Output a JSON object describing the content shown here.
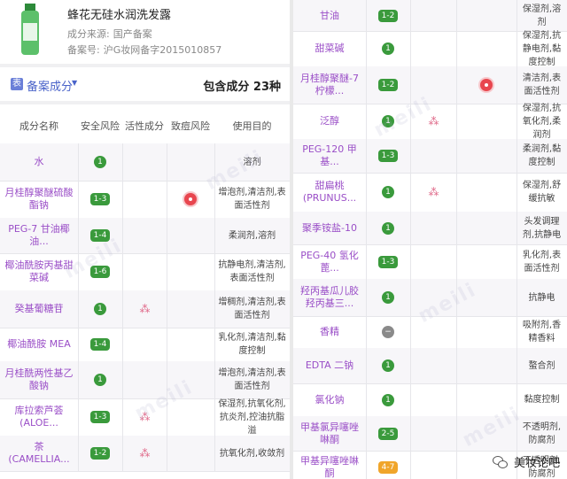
{
  "product": {
    "title": "蜂花无硅水润洗发露",
    "source_label": "成分来源:",
    "source_value": "国产备案",
    "record_label": "备案号:",
    "record_value": "沪G妆网备字2015010857"
  },
  "section": {
    "icon_text": "表",
    "label": "备案成分",
    "count_text": "包含成分 23种"
  },
  "table_headers": [
    "成分名称",
    "安全风险",
    "活性成分",
    "致痘风险",
    "使用目的"
  ],
  "left_rows": [
    {
      "name": "水",
      "safety": "1",
      "active": false,
      "acne": false,
      "purpose": "溶剂"
    },
    {
      "name": "月桂醇聚醚硫酸酯钠",
      "safety": "1-3",
      "active": false,
      "acne": true,
      "purpose": "增泡剂,清洁剂,表面活性剂"
    },
    {
      "name": "PEG-7 甘油椰油...",
      "safety": "1-4",
      "active": false,
      "acne": false,
      "purpose": "柔润剂,溶剂"
    },
    {
      "name": "椰油酰胺丙基甜菜碱",
      "safety": "1-6",
      "active": false,
      "acne": false,
      "purpose": "抗静电剂,清洁剂,表面活性剂"
    },
    {
      "name": "癸基葡糖苷",
      "safety": "1",
      "active": true,
      "acne": false,
      "purpose": "增稠剂,清洁剂,表面活性剂"
    },
    {
      "name": "椰油酰胺 MEA",
      "safety": "1-4",
      "active": false,
      "acne": false,
      "purpose": "乳化剂,清洁剂,黏度控制"
    },
    {
      "name": "月桂酰两性基乙酸钠",
      "safety": "1",
      "active": false,
      "acne": false,
      "purpose": "增泡剂,清洁剂,表面活性剂"
    },
    {
      "name": "库拉索芦荟(ALOE...",
      "safety": "1-3",
      "active": true,
      "acne": false,
      "purpose": "保湿剂,抗氧化剂,抗炎剂,控油抗脂溢"
    },
    {
      "name": "茶(CAMELLIA...",
      "safety": "1-2",
      "active": true,
      "acne": false,
      "purpose": "抗氧化剂,收敛剂"
    }
  ],
  "right_rows": [
    {
      "name": "甘油",
      "safety": "1-2",
      "active": false,
      "acne": false,
      "purpose": "保湿剂,溶剂"
    },
    {
      "name": "甜菜碱",
      "safety": "1",
      "active": false,
      "acne": false,
      "purpose": "保湿剂,抗静电剂,黏度控制"
    },
    {
      "name": "月桂醇聚醚-7 柠檬...",
      "safety": "1-2",
      "active": false,
      "acne": true,
      "purpose": "清洁剂,表面活性剂"
    },
    {
      "name": "泛醇",
      "safety": "1",
      "active": true,
      "acne": false,
      "purpose": "保湿剂,抗氧化剂,柔润剂"
    },
    {
      "name": "PEG-120 甲基...",
      "safety": "1-3",
      "active": false,
      "acne": false,
      "purpose": "柔润剂,黏度控制"
    },
    {
      "name": "甜扁桃(PRUNUS...",
      "safety": "1",
      "active": true,
      "acne": false,
      "purpose": "保湿剂,舒缓抗敏"
    },
    {
      "name": "聚季铵盐-10",
      "safety": "1",
      "active": false,
      "acne": false,
      "purpose": "头发调理剂,抗静电"
    },
    {
      "name": "PEG-40 氢化蓖...",
      "safety": "1-3",
      "active": false,
      "acne": false,
      "purpose": "乳化剂,表面活性剂"
    },
    {
      "name": "羟丙基瓜儿胶羟丙基三...",
      "safety": "1",
      "active": false,
      "acne": false,
      "purpose": "抗静电"
    },
    {
      "name": "香精",
      "safety": "-",
      "active": false,
      "acne": false,
      "purpose": "吸附剂,香精香料"
    },
    {
      "name": "EDTA 二钠",
      "safety": "1",
      "active": false,
      "acne": false,
      "purpose": "螯合剂"
    },
    {
      "name": "氯化钠",
      "safety": "1",
      "active": false,
      "acne": false,
      "purpose": "黏度控制"
    },
    {
      "name": "甲基氯异噻唑啉酮",
      "safety": "2-5",
      "active": false,
      "acne": false,
      "purpose": "不透明剂,防腐剂"
    },
    {
      "name": "甲基异噻唑啉酮",
      "safety": "4-7",
      "active": false,
      "acne": false,
      "purpose": "不透明剂,防腐剂"
    }
  ],
  "brand_text": "美妆论吧",
  "colors": {
    "badge_green": "#3a9a3c",
    "badge_orange": "#f0a52a",
    "name_purple": "#9a4ec7",
    "link_blue": "#4a63c9"
  }
}
